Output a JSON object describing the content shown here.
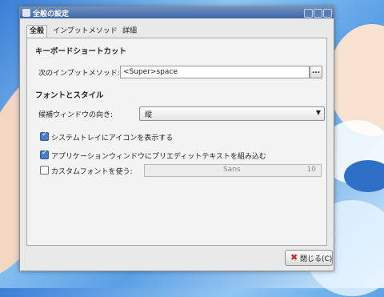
{
  "window": {
    "title": "全般の設定"
  },
  "tabs": [
    {
      "label": "全般"
    },
    {
      "label": "インプットメソッド"
    },
    {
      "label": "詳細"
    }
  ],
  "keyboard_section": {
    "heading": "キーボードショートカット",
    "next_im_label": "次のインプットメソッド:",
    "next_im_value": "<Super>space",
    "browse_label": "..."
  },
  "font_section": {
    "heading": "フォントとスタイル",
    "orientation_label": "候補ウィンドウの向き:",
    "orientation_value": "縦",
    "show_systray": {
      "label": "システムトレイにアイコンを表示する",
      "checked": true
    },
    "embed_preedit": {
      "label": "アプリケーションウィンドウにプリエディットテキストを組み込む",
      "checked": true
    },
    "custom_font": {
      "label": "カスタムフォントを使う:",
      "checked": false,
      "font": "Sans",
      "size": "10"
    }
  },
  "footer": {
    "close_label": "閉じる(C)"
  },
  "icons": {
    "close": "close-icon",
    "dropdown": "chevron-down-icon"
  }
}
